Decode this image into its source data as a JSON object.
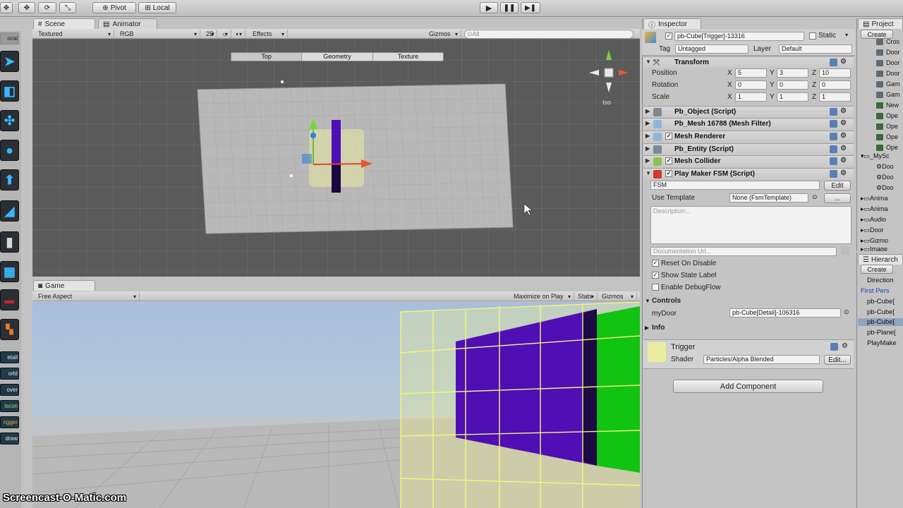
{
  "toolbar": {
    "pivot": "Pivot",
    "local": "Local"
  },
  "scene": {
    "tab": "Scene",
    "animator_tab": "Animator",
    "render_mode": "Textured",
    "color_mode": "RGB",
    "mode_2d": "2D",
    "effects": "Effects",
    "gizmos": "Gizmos",
    "search": "⊙All",
    "view_buttons": [
      "Top",
      "Geometry",
      "Texture"
    ],
    "iso": "Iso"
  },
  "left_buttons": [
    "etail",
    "orld",
    "over",
    "iscon",
    "rigger",
    "draw"
  ],
  "left_local": "ocal",
  "game": {
    "tab": "Game",
    "aspect": "Free Aspect",
    "maximize": "Maximize on Play",
    "stats": "Stats",
    "gizmos": "Gizmos"
  },
  "inspector": {
    "tab": "Inspector",
    "object_name": "pb-Cube[Trigger]-13316",
    "static": "Static",
    "tag_label": "Tag",
    "tag_value": "Untagged",
    "layer_label": "Layer",
    "layer_value": "Default",
    "transform": {
      "title": "Transform",
      "rows": [
        {
          "label": "Position",
          "x": "5",
          "y": "3",
          "z": "10"
        },
        {
          "label": "Rotation",
          "x": "0",
          "y": "0",
          "z": "0"
        },
        {
          "label": "Scale",
          "x": "1",
          "y": "1",
          "z": "1"
        }
      ]
    },
    "components": [
      "Pb_Object (Script)",
      "Pb_Mesh 16788 (Mesh Filter)",
      "Mesh Renderer",
      "Pb_Entity (Script)",
      "Mesh Collider",
      "Play Maker FSM (Script)"
    ],
    "fsm": {
      "name": "FSM",
      "edit": "Edit",
      "use_template_label": "Use Template",
      "use_template_value": "None (FsmTemplate)",
      "dots": "...",
      "description_placeholder": "Description...",
      "doc_url_placeholder": "Documentation Url...",
      "reset_on_disable": "Reset On Disable",
      "show_state_label": "Show State Label",
      "enable_debug_flow": "Enable DebugFlow"
    },
    "controls": {
      "title": "Controls",
      "label": "myDoor",
      "value": "pb-Cube[Detail]-106316"
    },
    "info": "Info",
    "material": {
      "name": "Trigger",
      "shader_label": "Shader",
      "shader_value": "Particles/Alpha Blended",
      "edit": "Edit..."
    },
    "add_component": "Add Component"
  },
  "project": {
    "tab": "Project",
    "create": "Create",
    "items": [
      "Cros",
      "Door",
      "Door",
      "Door",
      "Gam",
      "Gam",
      "New",
      "Ope",
      "Ope",
      "Ope",
      "Ope"
    ],
    "folder_mysc": "_MySc",
    "sub": [
      "Doo",
      "Doo",
      "Doo"
    ],
    "folders": [
      "Anima",
      "Anima",
      "Audio",
      "Door",
      "Gizmo",
      "Image"
    ]
  },
  "hierarchy": {
    "tab": "Hierarch",
    "create": "Create",
    "items": [
      "Direction",
      "First Pers",
      "pb-Cube[",
      "pb-Cube[",
      "pb-Cube[",
      "pb-Plane[",
      "PlayMake"
    ]
  },
  "watermark": "Screencast-O-Matic.com",
  "colors": {
    "accent_blue": "#3ab8ff",
    "selected_purple": "#4f0fb5",
    "door_green": "#11c411",
    "trigger_yellow": "#f2f28a"
  }
}
